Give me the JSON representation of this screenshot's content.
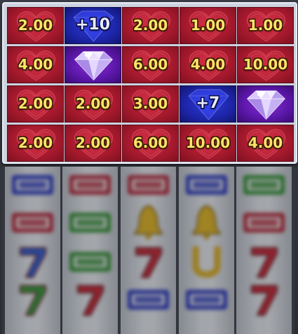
{
  "bonus_grid": {
    "rows": [
      [
        {
          "type": "value",
          "text": "2.00"
        },
        {
          "type": "add",
          "text": "+10"
        },
        {
          "type": "value",
          "text": "2.00"
        },
        {
          "type": "value",
          "text": "1.00"
        },
        {
          "type": "value",
          "text": "1.00"
        }
      ],
      [
        {
          "type": "value",
          "text": "4.00"
        },
        {
          "type": "diamond",
          "text": ""
        },
        {
          "type": "value",
          "text": "6.00"
        },
        {
          "type": "value",
          "text": "4.00"
        },
        {
          "type": "value",
          "text": "10.00"
        }
      ],
      [
        {
          "type": "value",
          "text": "2.00"
        },
        {
          "type": "value",
          "text": "2.00"
        },
        {
          "type": "value",
          "text": "3.00"
        },
        {
          "type": "add",
          "text": "+7"
        },
        {
          "type": "diamond",
          "text": ""
        }
      ],
      [
        {
          "type": "value",
          "text": "2.00"
        },
        {
          "type": "value",
          "text": "2.00"
        },
        {
          "type": "value",
          "text": "6.00"
        },
        {
          "type": "value",
          "text": "10.00"
        },
        {
          "type": "value",
          "text": "4.00"
        }
      ]
    ]
  },
  "reels": {
    "columns": [
      [
        "bar-blue-symbol",
        "bar-red-symbol",
        "seven-blue-symbol",
        "seven-green-symbol"
      ],
      [
        "bar-red-symbol",
        "bar-green-symbol",
        "bar-green-symbol",
        "seven-red-symbol"
      ],
      [
        "bar-red-symbol",
        "bell-symbol",
        "seven-red-symbol",
        "bar-blue-symbol"
      ],
      [
        "bar-blue-symbol",
        "bell-symbol",
        "horseshoe-symbol",
        "bar-blue-symbol"
      ],
      [
        "bar-green-symbol",
        "bar-red-symbol",
        "seven-red-symbol",
        "seven-red-symbol"
      ]
    ]
  },
  "colors": {
    "value_cell": "#a81a2e",
    "add_cell": "#1d25a8",
    "diamond_cell": "#5a17a8",
    "value_text": "#ffe46a",
    "add_text": "#e8eaff"
  }
}
